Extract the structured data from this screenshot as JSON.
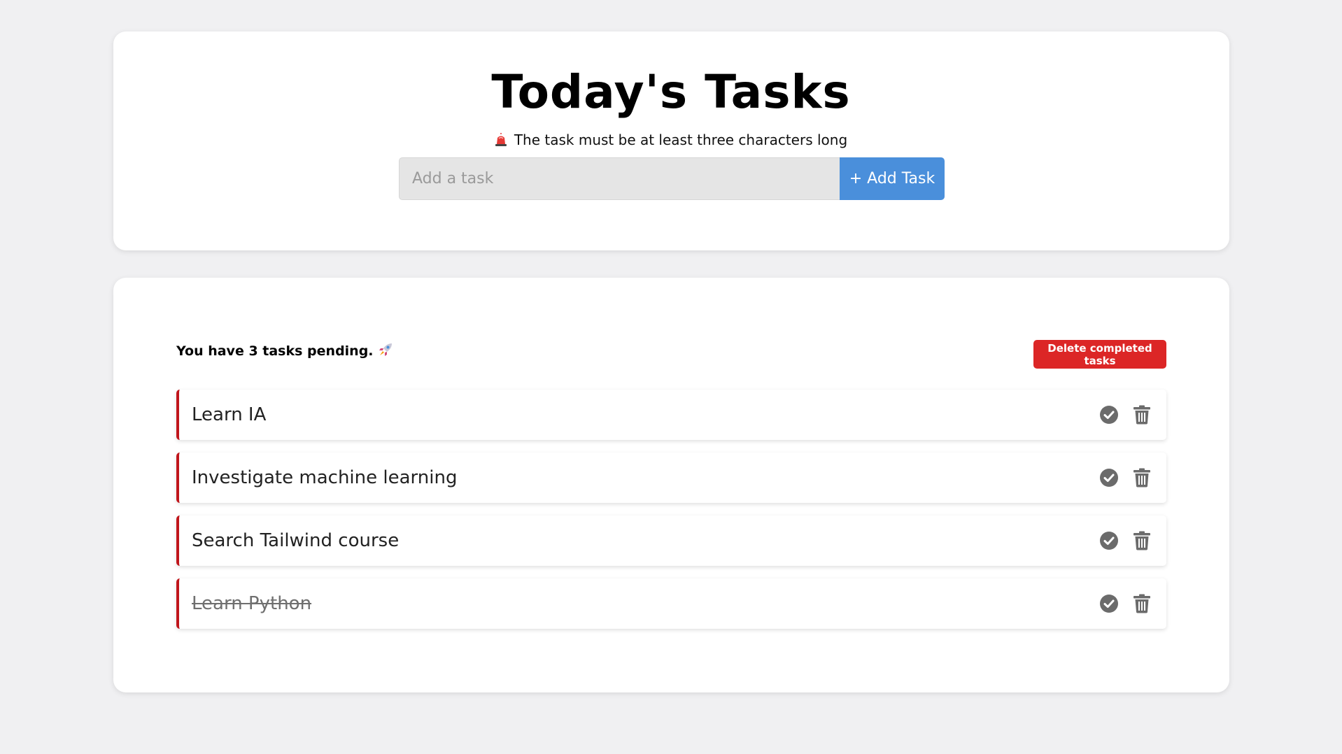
{
  "header": {
    "title": "Today's Tasks",
    "warning": "The task must be at least three characters long",
    "warning_icon": "siren-icon"
  },
  "form": {
    "input_placeholder": "Add a task",
    "input_value": "",
    "add_button_label": "+ Add Task"
  },
  "summary": {
    "pending_text": "You have 3 tasks pending.",
    "pending_icon": "rocket-icon",
    "delete_completed_label": "Delete completed tasks"
  },
  "tasks": [
    {
      "label": "Learn IA",
      "completed": false
    },
    {
      "label": "Investigate machine learning",
      "completed": false
    },
    {
      "label": "Search Tailwind course",
      "completed": false
    },
    {
      "label": "Learn Python",
      "completed": true
    }
  ],
  "colors": {
    "background": "#f0f0f2",
    "accent": "#4a8fdb",
    "danger": "#dc2626",
    "task_border": "#c0151b",
    "icon": "#6b6b6b"
  }
}
